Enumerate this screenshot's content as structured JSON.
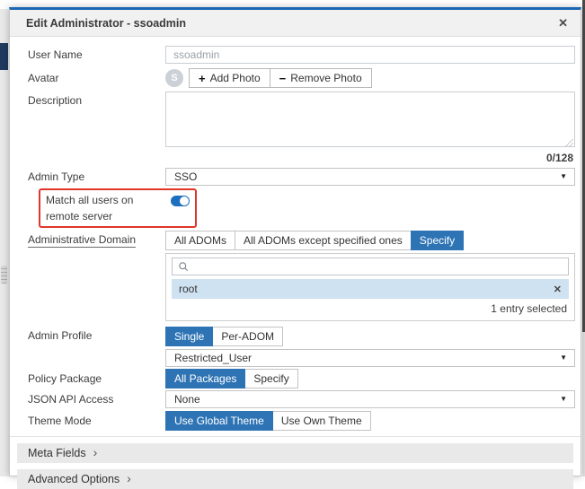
{
  "modal": {
    "title": "Edit Administrator - ssoadmin"
  },
  "icons": {
    "close": "✕",
    "remove_entry": "✕",
    "chevron_right": "›",
    "caret_down": "▼",
    "plus": "+",
    "minus": "−"
  },
  "colors": {
    "accent_blue": "#2e74b5",
    "toggle_blue": "#1d6fbf",
    "annotation_red": "#e0352b",
    "selected_row_bg": "#cfe2f2",
    "header_bg": "#f1f1f1",
    "modal_top_border": "#1b67b2"
  },
  "form": {
    "user_name": {
      "label": "User Name",
      "value": "ssoadmin"
    },
    "avatar": {
      "label": "Avatar",
      "initial": "S",
      "add_photo": "Add Photo",
      "remove_photo": "Remove Photo"
    },
    "description": {
      "label": "Description",
      "value": "",
      "char_counter": "0/128"
    },
    "admin_type": {
      "label": "Admin Type",
      "selected": "SSO"
    },
    "match_remote": {
      "label": "Match all users on remote server",
      "toggle_state": "on"
    },
    "administrative_domain": {
      "label": "Administrative Domain",
      "options": [
        "All ADOMs",
        "All ADOMs except specified ones",
        "Specify"
      ],
      "selected": "Specify",
      "selected_entries": [
        "root"
      ],
      "summary": "1 entry selected"
    },
    "admin_profile": {
      "label": "Admin Profile",
      "options": [
        "Single",
        "Per-ADOM"
      ],
      "selected": "Single",
      "profile": "Restricted_User"
    },
    "policy_package": {
      "label": "Policy Package",
      "options": [
        "All Packages",
        "Specify"
      ],
      "selected": "All Packages"
    },
    "json_api_access": {
      "label": "JSON API Access",
      "selected": "None"
    },
    "theme_mode": {
      "label": "Theme Mode",
      "options": [
        "Use Global Theme",
        "Use Own Theme"
      ],
      "selected": "Use Global Theme"
    }
  },
  "sections": [
    {
      "label": "Meta Fields"
    },
    {
      "label": "Advanced Options"
    }
  ]
}
